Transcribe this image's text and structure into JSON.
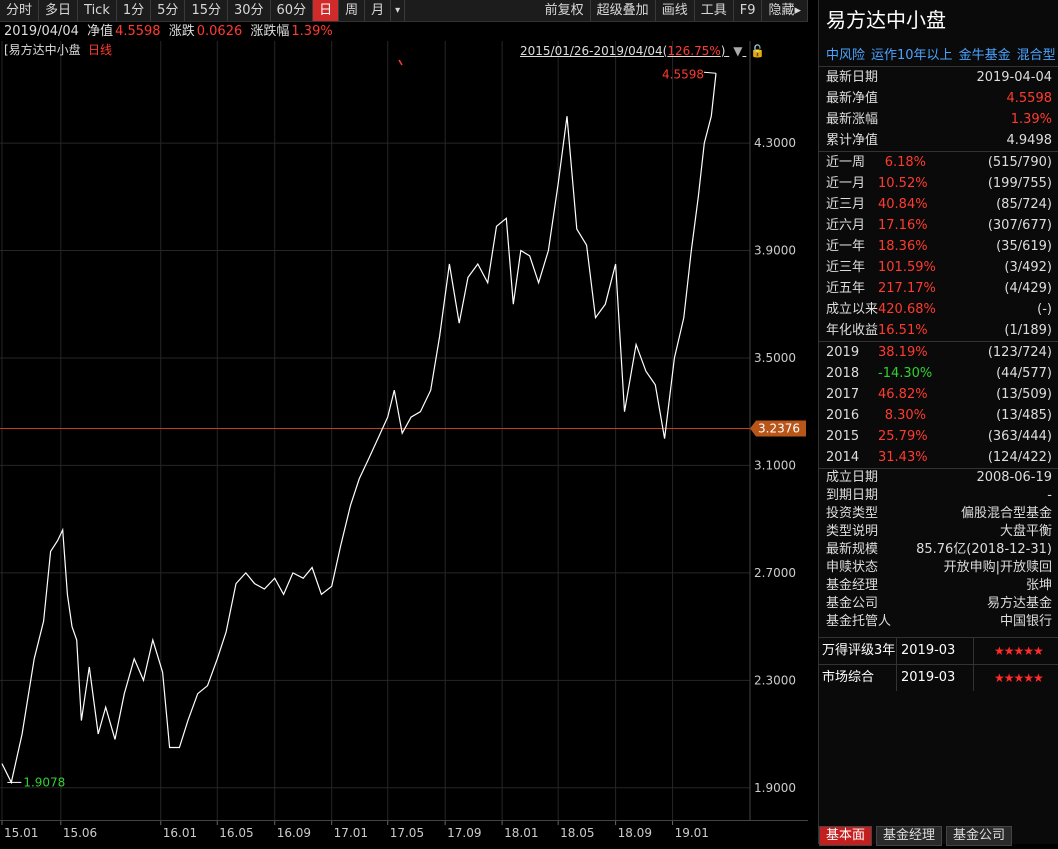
{
  "toolbar": {
    "left": [
      "分时",
      "多日",
      "Tick",
      "1分",
      "5分",
      "15分",
      "30分",
      "60分",
      "日",
      "周",
      "月",
      "▾"
    ],
    "active": "日",
    "right": [
      "前复权",
      "超级叠加",
      "画线",
      "工具",
      "F9",
      "隐藏▸"
    ]
  },
  "infoline": {
    "date": "2019/04/04",
    "nav_label": "净值",
    "nav_value": "4.5598",
    "chg_label": "涨跌",
    "chg_value": "0.0626",
    "chgpct_label": "涨跌幅",
    "chgpct_value": "1.39%"
  },
  "chart": {
    "name_tag": "[易方达中小盘",
    "period_tag": "日线",
    "range_text": "2015/01/26-2019/04/04(",
    "range_pct": "126.75%",
    "range_close": ")",
    "high_label": "4.5598",
    "low_label": "1.9078",
    "ref_label": "3.2376",
    "y_ticks": [
      "4.3000",
      "3.9000",
      "3.5000",
      "3.1000",
      "2.7000",
      "2.3000",
      "1.9000"
    ],
    "x_ticks": [
      "15.01",
      "15.06",
      "16.01",
      "16.05",
      "16.09",
      "17.01",
      "17.05",
      "17.09",
      "18.01",
      "18.05",
      "18.09",
      "19.01"
    ]
  },
  "chart_data": {
    "type": "line",
    "title": "易方达中小盘",
    "xlabel": "",
    "ylabel": "",
    "ylim": [
      1.78,
      4.68
    ],
    "reference_line": 3.2376,
    "series": [
      {
        "name": "日线",
        "x": [
          "2015-01-26",
          "2015-02-15",
          "2015-03-10",
          "2015-04-05",
          "2015-04-25",
          "2015-05-10",
          "2015-05-25",
          "2015-06-05",
          "2015-06-15",
          "2015-06-25",
          "2015-07-05",
          "2015-07-15",
          "2015-08-01",
          "2015-08-20",
          "2015-09-05",
          "2015-09-25",
          "2015-10-15",
          "2015-11-05",
          "2015-11-25",
          "2015-12-15",
          "2016-01-05",
          "2016-01-20",
          "2016-02-10",
          "2016-02-28",
          "2016-03-20",
          "2016-04-10",
          "2016-05-01",
          "2016-05-20",
          "2016-06-10",
          "2016-07-01",
          "2016-07-20",
          "2016-08-10",
          "2016-09-01",
          "2016-09-20",
          "2016-10-10",
          "2016-11-01",
          "2016-11-20",
          "2016-12-10",
          "2017-01-01",
          "2017-01-20",
          "2017-02-10",
          "2017-03-01",
          "2017-03-20",
          "2017-04-10",
          "2017-05-01",
          "2017-05-15",
          "2017-06-01",
          "2017-06-20",
          "2017-07-10",
          "2017-08-01",
          "2017-08-20",
          "2017-09-10",
          "2017-10-01",
          "2017-10-20",
          "2017-11-10",
          "2017-12-01",
          "2017-12-20",
          "2018-01-10",
          "2018-01-25",
          "2018-02-10",
          "2018-03-01",
          "2018-03-20",
          "2018-04-10",
          "2018-05-01",
          "2018-05-20",
          "2018-06-10",
          "2018-07-01",
          "2018-07-20",
          "2018-08-10",
          "2018-09-01",
          "2018-09-20",
          "2018-10-15",
          "2018-11-05",
          "2018-11-25",
          "2018-12-15",
          "2019-01-05",
          "2019-01-25",
          "2019-02-10",
          "2019-02-25",
          "2019-03-10",
          "2019-03-25",
          "2019-04-04"
        ],
        "values": [
          1.99,
          1.92,
          2.1,
          2.38,
          2.52,
          2.78,
          2.82,
          2.86,
          2.62,
          2.5,
          2.45,
          2.15,
          2.35,
          2.1,
          2.2,
          2.08,
          2.25,
          2.38,
          2.3,
          2.45,
          2.33,
          2.05,
          2.05,
          2.15,
          2.25,
          2.28,
          2.38,
          2.48,
          2.66,
          2.7,
          2.66,
          2.64,
          2.68,
          2.62,
          2.7,
          2.68,
          2.72,
          2.62,
          2.65,
          2.8,
          2.95,
          3.05,
          3.12,
          3.2,
          3.28,
          3.38,
          3.22,
          3.28,
          3.3,
          3.38,
          3.58,
          3.85,
          3.63,
          3.8,
          3.85,
          3.78,
          3.99,
          4.02,
          3.7,
          3.9,
          3.88,
          3.78,
          3.9,
          4.15,
          4.4,
          3.98,
          3.92,
          3.65,
          3.7,
          3.85,
          3.3,
          3.55,
          3.45,
          3.4,
          3.2,
          3.5,
          3.65,
          3.9,
          4.1,
          4.3,
          4.4,
          4.5598
        ]
      }
    ],
    "x_tick_labels": [
      "15.01",
      "15.06",
      "16.01",
      "16.05",
      "16.09",
      "17.01",
      "17.05",
      "17.09",
      "18.01",
      "18.05",
      "18.09",
      "19.01"
    ],
    "y_tick_labels": [
      "4.3000",
      "3.9000",
      "3.5000",
      "3.1000",
      "2.7000",
      "2.3000",
      "1.9000"
    ],
    "grid": true
  },
  "panel": {
    "title": "易方达中小盘",
    "tags": [
      "中风险",
      "运作10年以上",
      "金牛基金",
      "混合型"
    ],
    "summary": [
      {
        "k": "最新日期",
        "v": "2019-04-04",
        "c": "normal"
      },
      {
        "k": "最新净值",
        "v": "4.5598",
        "c": "red"
      },
      {
        "k": "最新涨幅",
        "v": "1.39%",
        "c": "red"
      },
      {
        "k": "累计净值",
        "v": "4.9498",
        "c": "normal"
      }
    ],
    "perf": [
      {
        "k": "近一周",
        "pct": "6.18%",
        "rank": "(515/790)",
        "c": "red"
      },
      {
        "k": "近一月",
        "pct": "10.52%",
        "rank": "(199/755)",
        "c": "red"
      },
      {
        "k": "近三月",
        "pct": "40.84%",
        "rank": "(85/724)",
        "c": "red"
      },
      {
        "k": "近六月",
        "pct": "17.16%",
        "rank": "(307/677)",
        "c": "red"
      },
      {
        "k": "近一年",
        "pct": "18.36%",
        "rank": "(35/619)",
        "c": "red"
      },
      {
        "k": "近三年",
        "pct": "101.59%",
        "rank": "(3/492)",
        "c": "red"
      },
      {
        "k": "近五年",
        "pct": "217.17%",
        "rank": "(4/429)",
        "c": "red"
      },
      {
        "k": "成立以来",
        "pct": "420.68%",
        "rank": "(-)",
        "c": "red"
      },
      {
        "k": "年化收益",
        "pct": "16.51%",
        "rank": "(1/189)",
        "c": "red"
      }
    ],
    "years": [
      {
        "k": "2019",
        "pct": "38.19%",
        "rank": "(123/724)",
        "c": "red"
      },
      {
        "k": "2018",
        "pct": "-14.30%",
        "rank": "(44/577)",
        "c": "green"
      },
      {
        "k": "2017",
        "pct": "46.82%",
        "rank": "(13/509)",
        "c": "red"
      },
      {
        "k": "2016",
        "pct": "8.30%",
        "rank": "(13/485)",
        "c": "red"
      },
      {
        "k": "2015",
        "pct": "25.79%",
        "rank": "(363/444)",
        "c": "red"
      },
      {
        "k": "2014",
        "pct": "31.43%",
        "rank": "(124/422)",
        "c": "red"
      }
    ],
    "info": [
      {
        "k": "成立日期",
        "v": "2008-06-19"
      },
      {
        "k": "到期日期",
        "v": "-"
      },
      {
        "k": "投资类型",
        "v": "偏股混合型基金"
      },
      {
        "k": "类型说明",
        "v": "大盘平衡"
      },
      {
        "k": "最新规模",
        "v": "85.76亿(2018-12-31)"
      },
      {
        "k": "申赎状态",
        "v": "开放申购|开放赎回"
      },
      {
        "k": "基金经理",
        "v": "张坤"
      },
      {
        "k": "基金公司",
        "v": "易方达基金"
      },
      {
        "k": "基金托管人",
        "v": "中国银行"
      }
    ],
    "ratings": [
      {
        "k": "万得评级3年",
        "d": "2019-03",
        "s": "★★★★★"
      },
      {
        "k": "市场综合",
        "d": "2019-03",
        "s": "★★★★★"
      }
    ],
    "tabs": [
      "基本面",
      "基金经理",
      "基金公司"
    ],
    "active_tab": "基本面"
  },
  "colors": {
    "red": "#ff3b30",
    "green": "#2fd12f",
    "ref_line": "#c0401a",
    "ref_badge": "#b8561a",
    "accent_tab": "#d12a2a"
  }
}
